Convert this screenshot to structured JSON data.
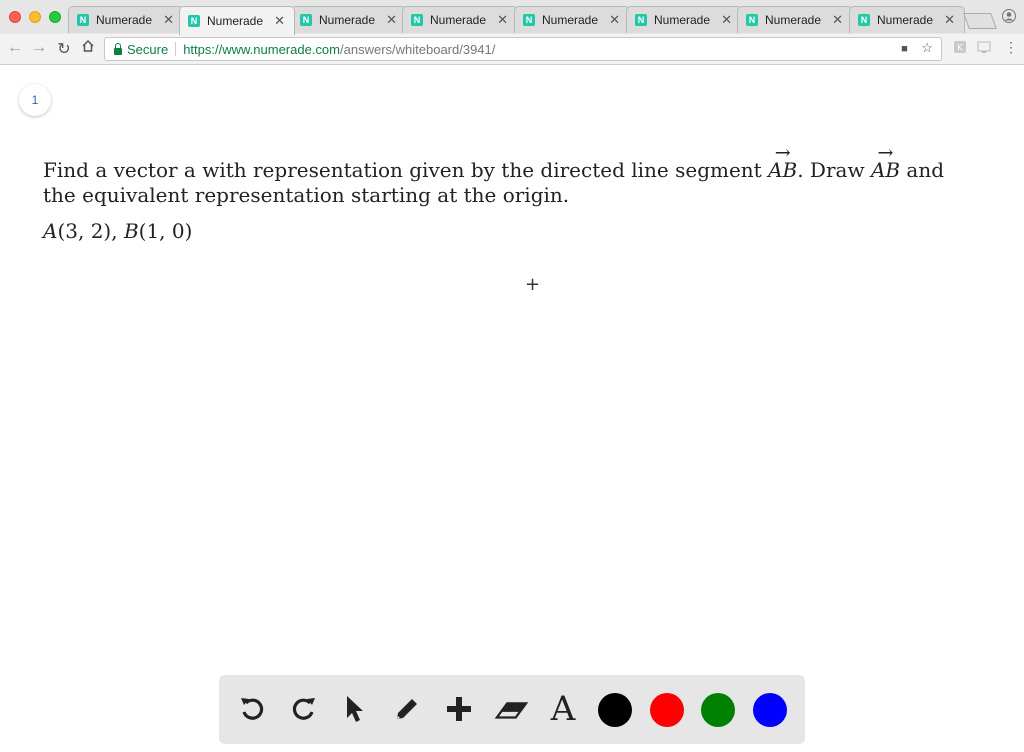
{
  "browser": {
    "tabs": [
      {
        "title": "Numerade",
        "active": false
      },
      {
        "title": "Numerade",
        "active": true
      },
      {
        "title": "Numerade",
        "active": false
      },
      {
        "title": "Numerade",
        "active": false
      },
      {
        "title": "Numerade",
        "active": false
      },
      {
        "title": "Numerade",
        "active": false
      },
      {
        "title": "Numerade",
        "active": false
      },
      {
        "title": "Numerade",
        "active": false
      }
    ],
    "secure_label": "Secure",
    "url_host": "https://www.numerade.com",
    "url_path": "/answers/whiteboard/3941/"
  },
  "page": {
    "page_number": "1",
    "question_part1": "Find a vector a with representation given by the directed line segment ",
    "vector_label": "AB",
    "question_part2": ". Draw ",
    "question_part3": " and the equivalent representation starting at the origin.",
    "point_a_name": "A",
    "point_a_coords": "(3, 2),",
    "point_b_name": "B",
    "point_b_coords": "(1, 0)"
  },
  "whiteboard_toolbar": {
    "tools": [
      "undo-icon",
      "redo-icon",
      "pointer-icon",
      "pencil-icon",
      "add-icon",
      "eraser-icon",
      "text-icon"
    ],
    "text_tool_glyph": "A",
    "colors": [
      "#000000",
      "#ff0000",
      "#008000",
      "#0000ff"
    ]
  }
}
